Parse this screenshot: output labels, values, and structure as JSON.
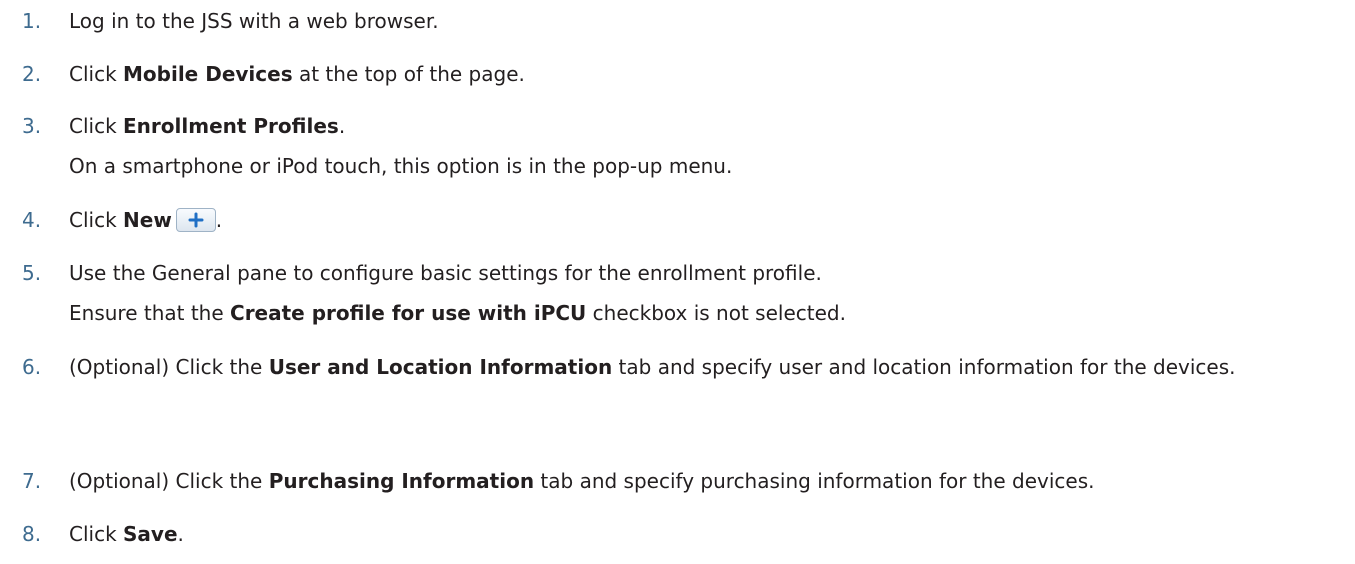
{
  "steps": [
    {
      "number": "1.",
      "text": "Log in to the JSS with a web browser."
    },
    {
      "number": "2.",
      "pre": "Click ",
      "bold": "Mobile Devices",
      "post": " at the top of the page."
    },
    {
      "number": "3.",
      "pre": "Click ",
      "bold": "Enrollment Profiles",
      "post": ".",
      "note": "On a smartphone or iPod touch, this option is in the pop-up menu."
    },
    {
      "number": "4.",
      "pre": "Click ",
      "bold": "New",
      "post": ".",
      "button_icon": "plus-icon"
    },
    {
      "number": "5.",
      "text": "Use the General pane to configure basic settings for the enrollment profile.",
      "note_pre": "Ensure that the ",
      "note_bold": "Create profile for use with iPCU",
      "note_post": " checkbox is not selected."
    },
    {
      "number": "6.",
      "pre": "(Optional) Click the ",
      "bold": "User and Location Information",
      "post": " tab and specify user and location information for the devices."
    },
    {
      "number": "7.",
      "pre": "(Optional) Click the ",
      "bold": "Purchasing Information",
      "post": " tab and specify purchasing information for the devices."
    },
    {
      "number": "8.",
      "pre": "Click ",
      "bold": "Save",
      "post": "."
    }
  ],
  "colors": {
    "number": "#3e6b8f",
    "text": "#231f20",
    "button_border": "#9fb3c6",
    "plus": "#1f6fc5"
  }
}
